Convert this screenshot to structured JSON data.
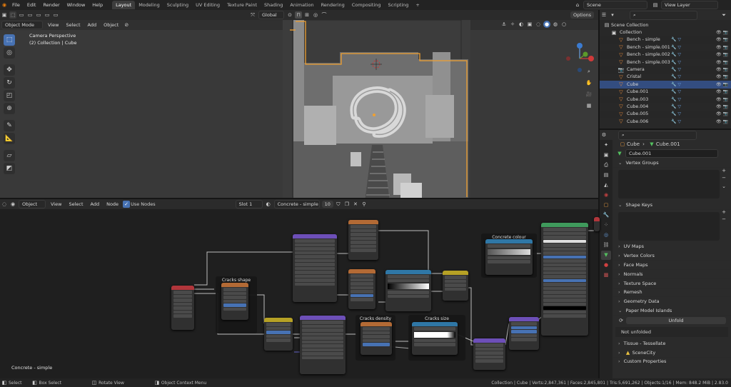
{
  "topbar": {
    "menus": [
      "File",
      "Edit",
      "Render",
      "Window",
      "Help"
    ],
    "workspaces": [
      "Layout",
      "Modeling",
      "Sculpting",
      "UV Editing",
      "Texture Paint",
      "Shading",
      "Animation",
      "Rendering",
      "Compositing",
      "Scripting",
      "+"
    ],
    "active_workspace": "Layout",
    "scene": "Scene",
    "view_layer": "View Layer"
  },
  "viewport": {
    "mode": "Object Mode",
    "menus": [
      "View",
      "Select",
      "Add",
      "Object"
    ],
    "transform_orientation": "Global",
    "options_label": "Options",
    "overlay_title": "Camera Perspective",
    "overlay_subtitle": "(2) Collection | Cube"
  },
  "outliner": {
    "root": "Scene Collection",
    "items": [
      {
        "label": "Collection",
        "kind": "collection"
      },
      {
        "label": "Bench - simple",
        "kind": "mesh"
      },
      {
        "label": "Bench - simple.001",
        "kind": "mesh"
      },
      {
        "label": "Bench - simple.002",
        "kind": "mesh"
      },
      {
        "label": "Bench - simple.003",
        "kind": "mesh"
      },
      {
        "label": "Camera",
        "kind": "camera"
      },
      {
        "label": "Cristal",
        "kind": "mesh"
      },
      {
        "label": "Cube",
        "kind": "mesh",
        "selected": true
      },
      {
        "label": "Cube.001",
        "kind": "mesh"
      },
      {
        "label": "Cube.003",
        "kind": "mesh"
      },
      {
        "label": "Cube.004",
        "kind": "mesh"
      },
      {
        "label": "Cube.005",
        "kind": "mesh"
      },
      {
        "label": "Cube.006",
        "kind": "mesh"
      }
    ]
  },
  "properties": {
    "object": "Cube",
    "mesh": "Cube.001",
    "datablock": "Cube.001",
    "sections": [
      "Vertex Groups",
      "Shape Keys",
      "UV Maps",
      "Vertex Colors",
      "Face Maps",
      "Normals",
      "Texture Space",
      "Remesh",
      "Geometry Data",
      "Paper Model Islands"
    ],
    "unfold_button": "Unfold",
    "not_unfolded": "Not unfolded",
    "extra_sections": [
      "Tissue - Tessellate",
      "SceneCity",
      "Custom Properties"
    ]
  },
  "node_editor": {
    "editor": "Object",
    "menus": [
      "View",
      "Select",
      "Add",
      "Node"
    ],
    "use_nodes": "Use Nodes",
    "slot": "Slot 1",
    "material": "Concrete - simple",
    "users": "10",
    "material_label": "Concrete - simple",
    "frames": [
      "Cracks shape",
      "Cracks density",
      "Cracks size",
      "Concrete colour"
    ]
  },
  "status": {
    "left": [
      "Select",
      "Box Select",
      "Rotate View",
      "Object Context Menu"
    ],
    "right": "Collection | Cube | Verts:2,847,361 | Faces:2,845,801 | Tris:5,691,262 | Objects:1/16 | Mem: 848.2 MiB | 2.83.0"
  },
  "colors": {
    "accent": "#4772b3",
    "selection_orange": "#f0a030",
    "frame_bg": "#171717"
  }
}
